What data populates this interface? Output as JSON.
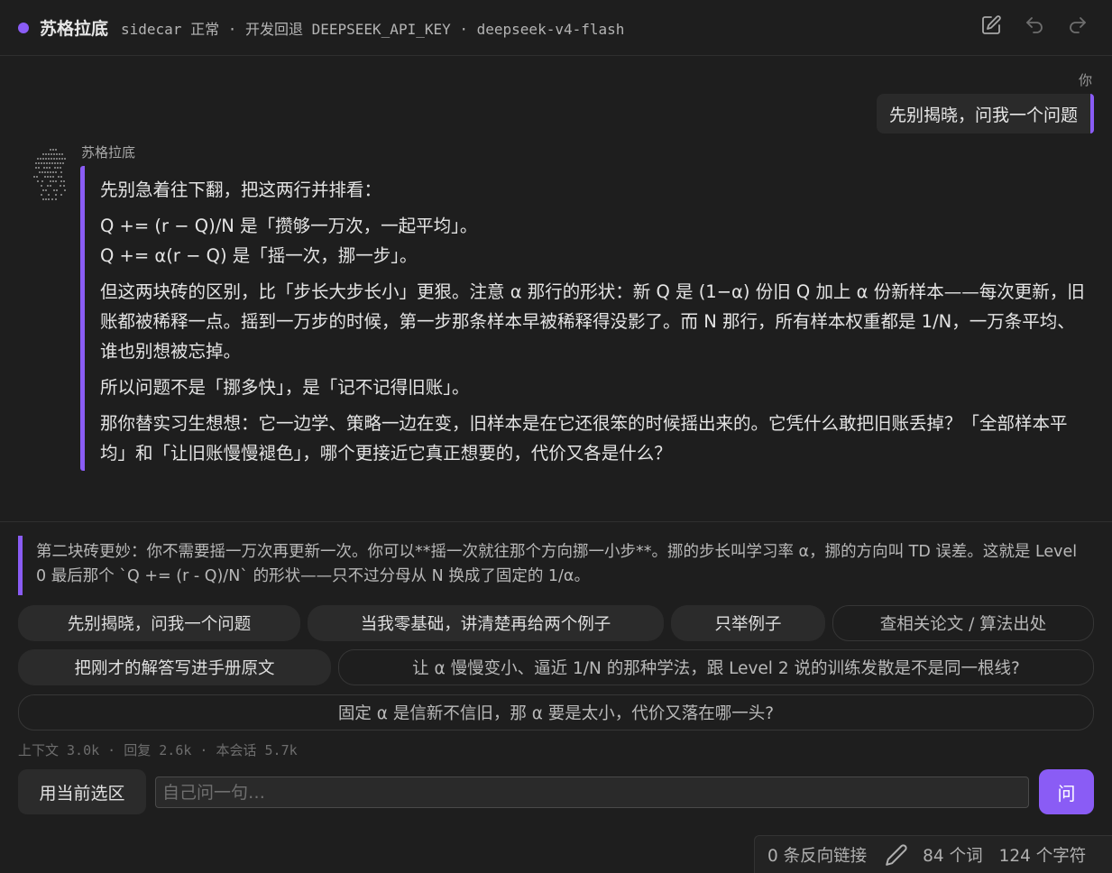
{
  "header": {
    "title": "苏格拉底",
    "status": "sidecar 正常 · 开发回退 DEEPSEEK_API_KEY · deepseek-v4-flash",
    "status_dot_color": "#8a5cf5",
    "actions": [
      "edit-icon",
      "undo-icon",
      "redo-icon"
    ]
  },
  "conversation": {
    "user_label": "你",
    "user_message": "先别揭晓，问我一个问题",
    "bot_name": "苏格拉底",
    "bot_paragraphs": [
      "先别急着往下翻，把这两行并排看：",
      "Q += (r − Q)/N 是「攒够一万次，一起平均」。",
      "Q += α(r − Q) 是「摇一次，挪一步」。",
      "但这两块砖的区别，比「步长大步长小」更狠。注意 α 那行的形状：新 Q 是 (1−α) 份旧 Q 加上 α 份新样本——每次更新，旧账都被稀释一点。摇到一万步的时候，第一步那条样本早被稀释得没影了。而 N 那行，所有样本权重都是 1/N，一万条平均、谁也别想被忘掉。",
      "所以问题不是「挪多快」，是「记不记得旧账」。",
      "那你替实习生想想：它一边学、策略一边在变，旧样本是在它还很笨的时候摇出来的。它凭什么敢把旧账丢掉？「全部样本平均」和「让旧账慢慢褪色」，哪个更接近它真正想要的，代价又各是什么？"
    ]
  },
  "quote": "第二块砖更妙：你不需要摇一万次再更新一次。你可以**摇一次就往那个方向挪一小步**。挪的步长叫学习率 α，挪的方向叫 TD 误差。这就是 Level 0 最后那个 `Q += (r - Q)/N` 的形状——只不过分母从 N 换成了固定的 1/α。",
  "suggestions": [
    "先别揭晓，问我一个问题",
    "当我零基础，讲清楚再给两个例子",
    "只举例子",
    "查相关论文 / 算法出处",
    "把刚才的解答写进手册原文",
    "让 α 慢慢变小、逼近 1/N 的那种学法，跟 Level 2 说的训练发散是不是同一根线?",
    "固定 α 是信新不信旧，那 α 要是太小，代价又落在哪一头?"
  ],
  "stats": "上下文 3.0k · 回复 2.6k · 本会话 5.7k",
  "composer": {
    "selection_button": "用当前选区",
    "placeholder": "自己问一句…",
    "value": "",
    "ask_button": "问"
  },
  "statusbar": {
    "backlinks": "0 条反向链接",
    "words": "84 个词",
    "chars": "124 个字符"
  },
  "colors": {
    "accent": "#8a5cf5",
    "background": "#1e1e1e",
    "chip": "#2b2b2b"
  }
}
